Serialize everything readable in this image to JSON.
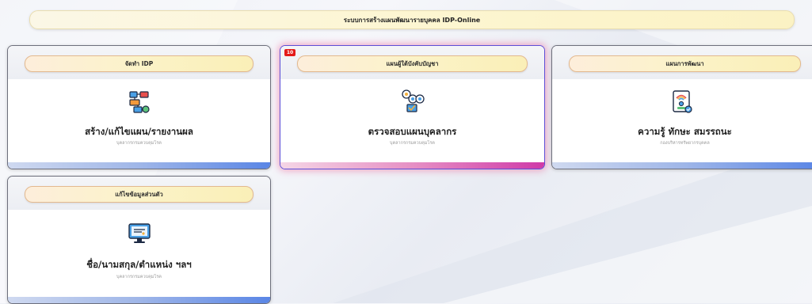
{
  "header": {
    "title": "ระบบการสร้างแผนพัฒนารายบุคคล IDP-Online"
  },
  "cards": [
    {
      "header_label": "จัดทำ IDP",
      "main_label": "สร้าง/แก้ไขแผน/รายงานผล",
      "sub_label": "บุคลากรกรมควบคุมโรค",
      "icon": "flowchart-icon"
    },
    {
      "header_label": "แผนผู้ใต้บังคับบัญชา",
      "main_label": "ตรวจสอบแผนบุคลากร",
      "sub_label": "บุคลากรกรมควบคุมโรค",
      "icon": "team-review-icon",
      "badge": "10"
    },
    {
      "header_label": "แผนการพัฒนา",
      "main_label": "ความรู้ ทักษะ สมรรถนะ",
      "sub_label": "กองบริหารทรัพยากรบุคคล",
      "icon": "certificate-icon"
    },
    {
      "header_label": "แก้ไขข้อมูลส่วนตัว",
      "main_label": "ชื่อ/นามสกุล/ตำแหน่ง ฯลฯ",
      "sub_label": "บุคลากรกรมควบคุมโรค",
      "icon": "monitor-icon"
    }
  ],
  "colors": {
    "highlight_border": "#5c4ed6",
    "footer_blue": "#5a86e6",
    "footer_pink": "#cf3aa8",
    "badge": "#e41a1a"
  }
}
